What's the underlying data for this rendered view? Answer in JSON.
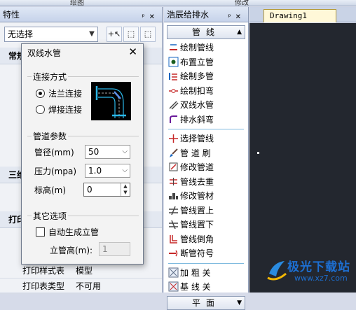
{
  "ribbon": {
    "group_left": "绘图",
    "group_right": "修改"
  },
  "properties": {
    "title": "特性",
    "selection": "无选择",
    "sections": {
      "general": "常规",
      "three_d": "三维",
      "print": "打印"
    },
    "rows": [
      {
        "label": "打印样式表",
        "value": "模型"
      },
      {
        "label": "打印表类型",
        "value": "不可用"
      }
    ]
  },
  "pipe_panel": {
    "title": "浩辰给排水",
    "categories": {
      "pipe": "管线",
      "section": "平面"
    },
    "items_group1": [
      {
        "label": "绘制管线",
        "icon": "draw-pipe-icon"
      },
      {
        "label": "布置立管",
        "icon": "riser-icon"
      },
      {
        "label": "绘制多管",
        "icon": "multi-pipe-icon"
      },
      {
        "label": "绘制扣弯",
        "icon": "bend-icon"
      },
      {
        "label": "双线水管",
        "icon": "double-line-icon"
      },
      {
        "label": "排水斜弯",
        "icon": "slope-bend-icon"
      }
    ],
    "items_group2": [
      {
        "label": "选择管线",
        "icon": "select-pipe-icon"
      },
      {
        "label": "管 道 刷",
        "icon": "brush-icon"
      },
      {
        "label": "修改管道",
        "icon": "edit-pipe-icon"
      },
      {
        "label": "管线去重",
        "icon": "dedupe-icon"
      },
      {
        "label": "修改管材",
        "icon": "material-icon"
      },
      {
        "label": "管线置上",
        "icon": "bring-up-icon"
      },
      {
        "label": "管线置下",
        "icon": "send-down-icon"
      },
      {
        "label": "管线倒角",
        "icon": "chamfer-icon"
      },
      {
        "label": "断管符号",
        "icon": "break-symbol-icon"
      }
    ],
    "items_group3": [
      {
        "label": "加 粗 关",
        "icon": "bold-off-icon"
      },
      {
        "label": "基 线 关",
        "icon": "baseline-off-icon"
      }
    ]
  },
  "drawing": {
    "tab": "Drawing1"
  },
  "dialog": {
    "title": "双线水管",
    "connection": {
      "group": "连接方式",
      "options": [
        "法兰连接",
        "焊接连接"
      ],
      "selected": "法兰连接"
    },
    "params": {
      "group": "管道参数",
      "diameter_label": "管径(mm)",
      "diameter_value": "50",
      "pressure_label": "压力(mpa)",
      "pressure_value": "1.0",
      "elevation_label": "标高(m)",
      "elevation_value": "0"
    },
    "other": {
      "group": "其它选项",
      "auto_riser_label": "自动生成立管",
      "auto_riser_checked": false,
      "riser_height_label": "立管高(m):",
      "riser_height_value": "1"
    }
  },
  "watermark": {
    "name": "极光下载站",
    "url": "www.xz7.com"
  },
  "colors": {
    "canvas": "#23272f",
    "accent_blue": "#1d6fd1",
    "dialog_bg": "#f3f3f3"
  }
}
